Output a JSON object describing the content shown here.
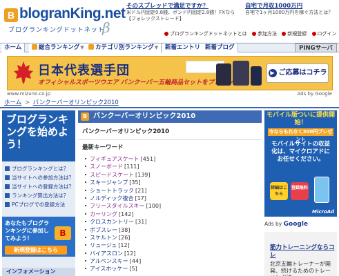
{
  "header": {
    "logo_mark": "B",
    "logo_word": "blogranKing.net",
    "logo_sub": "ブログランキングドットネット",
    "logo_version": "β",
    "ad1_title": "そのスプレッドで満足ですか？",
    "ad1_text": "米ドル円固定0.8銭、ポンド円固定2.8銭！FXなら【フォレックストレード】",
    "ad2_title": "自宅で月収1000万円",
    "ad2_text": "自宅で1ヶ月1000万円を稼ぐ方法とは？",
    "sublinks": [
      "ブログランキングドットネットとは",
      "参加方法",
      "新規登録",
      "ログイン"
    ]
  },
  "nav": {
    "tabs": [
      "ホーム",
      "総合ランキング",
      "カテゴリ別ランキング",
      "新着エントリ",
      "新着ブログ"
    ],
    "ping": "PINGサーバ"
  },
  "banner": {
    "title": "日本代表選手団",
    "subtitle": "オフィシャルスポーツウエア バンクーバー五輪商品セットをプレゼント!",
    "cta": "ご応募はコチラ",
    "url": "www.mizuno.co.jp",
    "ads_by": "Ads by Google"
  },
  "breadcrumb": {
    "home": "ホーム",
    "sep": ">",
    "current": "バンクーバーオリンピック2010"
  },
  "left": {
    "promo": "ブログランキングを始めよう！",
    "links": [
      "ブログランキングとは？",
      "当サイトへの参加方法は？",
      "当サイトへの登録方法は？",
      "ランキング算出方法は？",
      "PCブログでの登録方法"
    ],
    "reg_text": "あなたもブログランキングに参加してみよう！",
    "reg_badge": "B",
    "reg_button": "新規登録はこちら",
    "info_head": "インフォメーション"
  },
  "main": {
    "title": "バンクーバーオリンピック2010",
    "title_icon": "B",
    "subtitle": "バンクーバーオリンピック2010",
    "kw_head": "最新キーワード",
    "keywords": [
      {
        "name": "フィギュアスケート",
        "count": "[451]",
        "visited": true
      },
      {
        "name": "スノーボード",
        "count": "[111]",
        "visited": true
      },
      {
        "name": "スピードスケート",
        "count": "[139]",
        "visited": true
      },
      {
        "name": "スキージャンプ",
        "count": "[35]",
        "visited": false
      },
      {
        "name": "ショートトラック",
        "count": "[21]",
        "visited": false
      },
      {
        "name": "ノルディック複合",
        "count": "[17]",
        "visited": false
      },
      {
        "name": "フリースタイルスキー",
        "count": "[100]",
        "visited": true
      },
      {
        "name": "カーリング",
        "count": "[142]",
        "visited": true
      },
      {
        "name": "クロスカントリー",
        "count": "[31]",
        "visited": false
      },
      {
        "name": "ボブスレー",
        "count": "[38]",
        "visited": false
      },
      {
        "name": "スケルトン",
        "count": "[26]",
        "visited": false
      },
      {
        "name": "リュージュ",
        "count": "[12]",
        "visited": false
      },
      {
        "name": "バイアスロン",
        "count": "[12]",
        "visited": false
      },
      {
        "name": "アルペンスキー",
        "count": "[44]",
        "visited": false
      },
      {
        "name": "アイスホッケー",
        "count": "[5]",
        "visited": false
      }
    ]
  },
  "right": {
    "mobile_h1": "モバイル版ついに提供開始！",
    "mobile_h2": "今ならもれなく300円プレゼント",
    "mobile_body": "モバイルサイトの収益化は、マイクロアドにお任せください。",
    "btn1": "詳細はこちら",
    "btn2": "登録無料",
    "brand": "MicroAd",
    "ads_by_prefix": "Ads by",
    "ads_by_brand": "Google",
    "ad_title": "筋力トレーニングならコレ",
    "ad_body": "北京五輪トレーナーが開発、続けるためのトレーニング法"
  }
}
